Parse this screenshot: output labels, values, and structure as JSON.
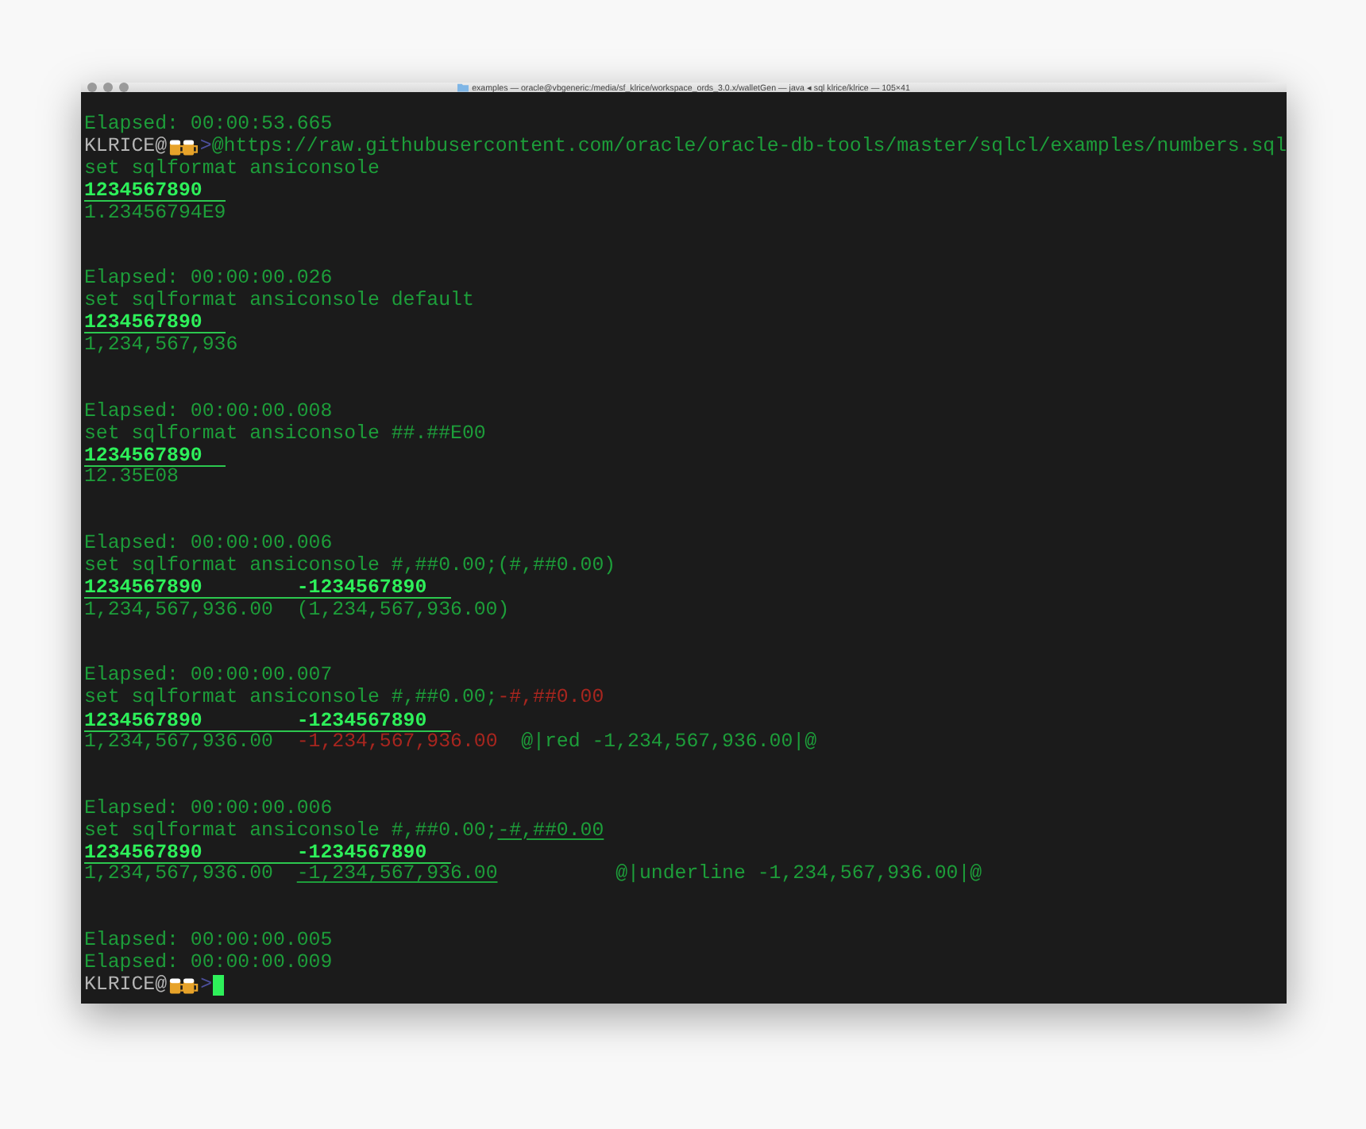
{
  "window": {
    "title": "examples — oracle@vbgeneric:/media/sf_klrice/workspace_ords_3.0.x/walletGen — java ◂ sql klrice/klrice — 105×41"
  },
  "blocks": [
    {
      "lines": [
        {
          "kind": "output",
          "segments": [
            {
              "text": "Elapsed: 00:00:53.665",
              "kind": "plain"
            }
          ]
        },
        {
          "kind": "prompt",
          "user": "KLRICE@",
          "symbol": ">",
          "command": "@https://raw.githubusercontent.com/oracle/oracle-db-tools/master/sqlcl/examples/numbers.sql"
        },
        {
          "kind": "output",
          "segments": [
            {
              "text": "set sqlformat ansiconsole",
              "kind": "plain"
            }
          ]
        },
        {
          "kind": "header",
          "text": "1234567890"
        },
        {
          "kind": "output",
          "segments": [
            {
              "text": "1.23456794E9",
              "kind": "plain"
            }
          ]
        }
      ]
    },
    {
      "lines": [
        {
          "kind": "output",
          "segments": [
            {
              "text": "Elapsed: 00:00:00.026",
              "kind": "plain"
            }
          ]
        },
        {
          "kind": "output",
          "segments": [
            {
              "text": "set sqlformat ansiconsole default",
              "kind": "plain"
            }
          ]
        },
        {
          "kind": "header",
          "text": "1234567890"
        },
        {
          "kind": "output",
          "segments": [
            {
              "text": "1,234,567,936",
              "kind": "plain"
            }
          ]
        }
      ]
    },
    {
      "lines": [
        {
          "kind": "output",
          "segments": [
            {
              "text": "Elapsed: 00:00:00.008",
              "kind": "plain"
            }
          ]
        },
        {
          "kind": "output",
          "segments": [
            {
              "text": "set sqlformat ansiconsole ##.##E00",
              "kind": "plain"
            }
          ]
        },
        {
          "kind": "header",
          "text": "1234567890"
        },
        {
          "kind": "output",
          "segments": [
            {
              "text": "12.35E08",
              "kind": "plain"
            }
          ]
        }
      ]
    },
    {
      "lines": [
        {
          "kind": "output",
          "segments": [
            {
              "text": "Elapsed: 00:00:00.006",
              "kind": "plain"
            }
          ]
        },
        {
          "kind": "output",
          "segments": [
            {
              "text": "set sqlformat ansiconsole #,##0.00;(#,##0.00)",
              "kind": "plain"
            }
          ]
        },
        {
          "kind": "header",
          "text": "1234567890        -1234567890"
        },
        {
          "kind": "output",
          "segments": [
            {
              "text": "1,234,567,936.00  (1,234,567,936.00)",
              "kind": "plain"
            }
          ]
        }
      ]
    },
    {
      "lines": [
        {
          "kind": "output",
          "segments": [
            {
              "text": "Elapsed: 00:00:00.007",
              "kind": "plain"
            }
          ]
        },
        {
          "kind": "output",
          "segments": [
            {
              "text": "set sqlformat ansiconsole #,##0.00;",
              "kind": "plain"
            },
            {
              "text": "-#,##0.00",
              "kind": "negative"
            }
          ]
        },
        {
          "kind": "header",
          "text": "1234567890        -1234567890"
        },
        {
          "kind": "output",
          "segments": [
            {
              "text": "1,234,567,936.00  ",
              "kind": "plain"
            },
            {
              "text": "-1,234,567,936.00",
              "kind": "negative"
            },
            {
              "text": "  @|red -1,234,567,936.00|@",
              "kind": "plain"
            }
          ]
        }
      ]
    },
    {
      "lines": [
        {
          "kind": "output",
          "segments": [
            {
              "text": "Elapsed: 00:00:00.006",
              "kind": "plain"
            }
          ]
        },
        {
          "kind": "output",
          "segments": [
            {
              "text": "set sqlformat ansiconsole #,##0.00;",
              "kind": "plain"
            },
            {
              "text": "-#,##0.00",
              "kind": "underlined"
            }
          ]
        },
        {
          "kind": "header",
          "text": "1234567890        -1234567890"
        },
        {
          "kind": "output",
          "segments": [
            {
              "text": "1,234,567,936.00  ",
              "kind": "plain"
            },
            {
              "text": "-1,234,567,936.00",
              "kind": "underlined"
            },
            {
              "text": "          @|underline -1,234,567,936.00|@",
              "kind": "plain"
            }
          ]
        }
      ]
    },
    {
      "lines": [
        {
          "kind": "output",
          "segments": [
            {
              "text": "Elapsed: 00:00:00.005",
              "kind": "plain"
            }
          ]
        },
        {
          "kind": "output",
          "segments": [
            {
              "text": "Elapsed: 00:00:00.009",
              "kind": "plain"
            }
          ]
        },
        {
          "kind": "prompt",
          "user": "KLRICE@",
          "symbol": ">",
          "cursor": true
        }
      ]
    }
  ]
}
